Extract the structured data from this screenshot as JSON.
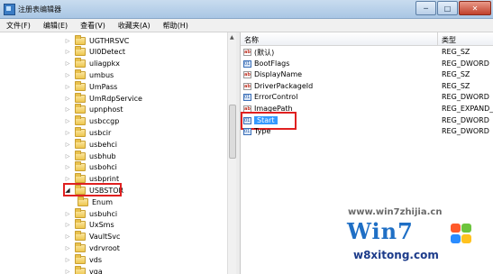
{
  "window": {
    "title": "注册表编辑器",
    "buttons": {
      "minimize": "─",
      "maximize": "□",
      "close": "✕"
    }
  },
  "menu": [
    "文件(F)",
    "编辑(E)",
    "查看(V)",
    "收藏夹(A)",
    "帮助(H)"
  ],
  "tree": {
    "items": [
      {
        "label": "UGTHRSVC",
        "expanded": false
      },
      {
        "label": "UI0Detect",
        "expanded": false
      },
      {
        "label": "uliagpkx",
        "expanded": false
      },
      {
        "label": "umbus",
        "expanded": false
      },
      {
        "label": "UmPass",
        "expanded": false
      },
      {
        "label": "UmRdpService",
        "expanded": false
      },
      {
        "label": "upnphost",
        "expanded": false
      },
      {
        "label": "usbccgp",
        "expanded": false
      },
      {
        "label": "usbcir",
        "expanded": false
      },
      {
        "label": "usbehci",
        "expanded": false
      },
      {
        "label": "usbhub",
        "expanded": false
      },
      {
        "label": "usbohci",
        "expanded": false
      },
      {
        "label": "usbprint",
        "expanded": false
      },
      {
        "label": "USBSTOR",
        "expanded": true,
        "highlighted": true
      },
      {
        "label": "Enum",
        "child": true
      },
      {
        "label": "usbuhci",
        "expanded": false
      },
      {
        "label": "UxSms",
        "expanded": false
      },
      {
        "label": "VaultSvc",
        "expanded": false
      },
      {
        "label": "vdrvroot",
        "expanded": false
      },
      {
        "label": "vds",
        "expanded": false
      },
      {
        "label": "vga",
        "expanded": false
      }
    ]
  },
  "values_pane": {
    "columns": {
      "name": "名称",
      "type": "类型"
    },
    "rows": [
      {
        "name": "(默认)",
        "type": "REG_SZ",
        "kind": "str",
        "icon_text": "ab"
      },
      {
        "name": "BootFlags",
        "type": "REG_DWORD",
        "kind": "bin",
        "icon_text": "011"
      },
      {
        "name": "DisplayName",
        "type": "REG_SZ",
        "kind": "str",
        "icon_text": "ab"
      },
      {
        "name": "DriverPackageId",
        "type": "REG_SZ",
        "kind": "str",
        "icon_text": "ab"
      },
      {
        "name": "ErrorControl",
        "type": "REG_DWORD",
        "kind": "bin",
        "icon_text": "011"
      },
      {
        "name": "ImagePath",
        "type": "REG_EXPAND_S",
        "kind": "str",
        "icon_text": "ab"
      },
      {
        "name": "Start",
        "type": "REG_DWORD",
        "kind": "bin",
        "icon_text": "011",
        "selected": true,
        "highlighted": true
      },
      {
        "name": "Type",
        "type": "REG_DWORD",
        "kind": "bin",
        "icon_text": "011"
      }
    ]
  },
  "watermark": {
    "url": "www.win7zhijia.cn",
    "logo_text": "Win7",
    "domain": "w8xitong.com"
  },
  "colors": {
    "highlight_border": "#e02020",
    "selection": "#3399ff",
    "folder": "#eec74f"
  }
}
